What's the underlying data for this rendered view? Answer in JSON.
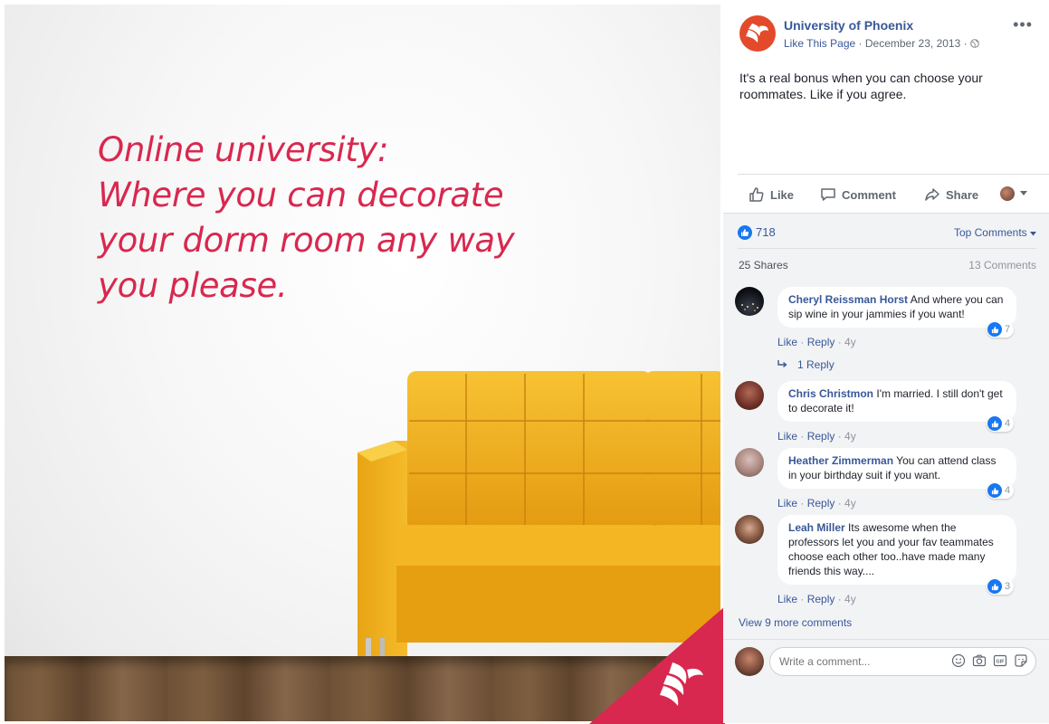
{
  "photo": {
    "headline_lines": [
      "Online university:",
      "Where you can decorate",
      "your dorm room any way",
      "you please."
    ],
    "accent_color": "#d8284f",
    "sofa_color": "#f2b51b"
  },
  "post": {
    "page_name": "University of Phoenix",
    "like_page": "Like This Page",
    "separator": "·",
    "date": "December 23, 2013",
    "text": "It's a real bonus when you can choose your roommates. Like if you agree.",
    "actions": {
      "like": "Like",
      "comment": "Comment",
      "share": "Share"
    },
    "reaction_count": "718",
    "top_comments": "Top Comments",
    "shares": "25 Shares",
    "comments_count": "13 Comments"
  },
  "comments": [
    {
      "author": "Cheryl Reissman Horst",
      "text": "And where you can sip wine in your jammies if you want!",
      "likes": "7",
      "like": "Like",
      "reply": "Reply",
      "age": "4y",
      "replies": "1 Reply"
    },
    {
      "author": "Chris Christmon",
      "text": "I'm married. I still don't get to decorate it!",
      "likes": "4",
      "like": "Like",
      "reply": "Reply",
      "age": "4y"
    },
    {
      "author": "Heather Zimmerman",
      "text": "You can attend class in your birthday suit if you want.",
      "likes": "4",
      "like": "Like",
      "reply": "Reply",
      "age": "4y"
    },
    {
      "author": "Leah Miller",
      "text": "Its awesome when the professors let you and your fav teammates choose each other too..have made many friends this way....",
      "likes": "3",
      "like": "Like",
      "reply": "Reply",
      "age": "4y"
    }
  ],
  "view_more": "View 9 more comments",
  "write_placeholder": "Write a comment...",
  "colors": {
    "link": "#385898",
    "brand": "#e24a2b",
    "like_blue": "#1877f2"
  }
}
